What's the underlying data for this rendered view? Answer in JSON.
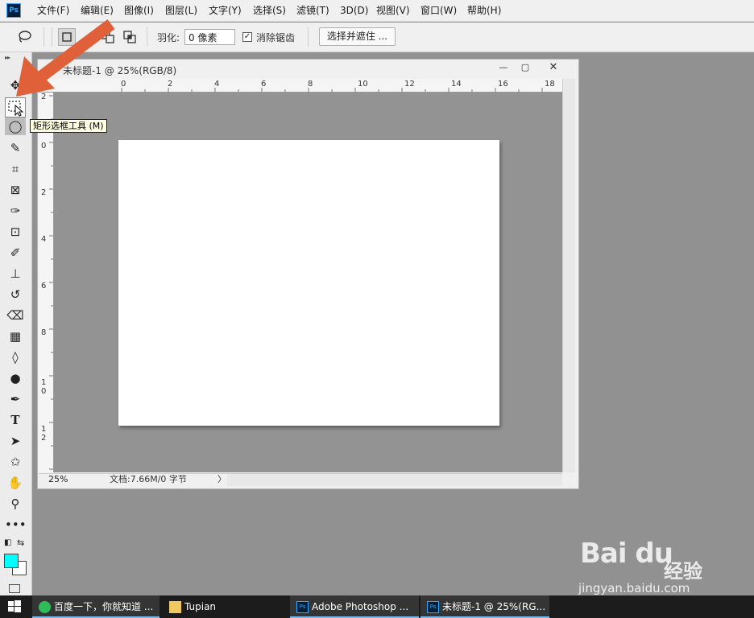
{
  "app": {
    "logo": "Ps"
  },
  "menu": [
    "文件(F)",
    "编辑(E)",
    "图像(I)",
    "图层(L)",
    "文字(Y)",
    "选择(S)",
    "滤镜(T)",
    "3D(D)",
    "视图(V)",
    "窗口(W)",
    "帮助(H)"
  ],
  "options": {
    "tool_icon": "lasso-icon",
    "feather_label": "羽化:",
    "feather_value": "0 像素",
    "antialias_checked": true,
    "antialias_label": "消除锯齿",
    "select_mask_label": "选择并遮住 ..."
  },
  "tooltip": "矩形选框工具 (M)",
  "document": {
    "title": "未标题-1 @ 25%(RGB/8)",
    "zoom": "25%",
    "info": "文档:7.66M/0 字节",
    "status_arrow": "〉"
  },
  "ruler": {
    "h": [
      "0",
      "2",
      "4",
      "6",
      "8",
      "10",
      "12",
      "14",
      "16",
      "18"
    ],
    "v": [
      "2",
      "0",
      "2",
      "4",
      "6",
      "8",
      "1\n0",
      "1\n2"
    ]
  },
  "colors": {
    "foreground": "#00ffff",
    "background": "#ffffff",
    "annotation_arrow": "#e0603a"
  },
  "taskbar": {
    "items": [
      {
        "label": "百度一下，你就知道 ...",
        "icon": "browser-icon"
      },
      {
        "label": "Tupian",
        "icon": "folder-icon"
      },
      {
        "label": "Adobe Photoshop ...",
        "icon": "photoshop-icon"
      },
      {
        "label": "未标题-1 @ 25%(RG...",
        "icon": "photoshop-icon"
      }
    ]
  },
  "watermark": {
    "logo": "Bai du",
    "cn": "经验",
    "url": "jingyan.baidu.com"
  }
}
